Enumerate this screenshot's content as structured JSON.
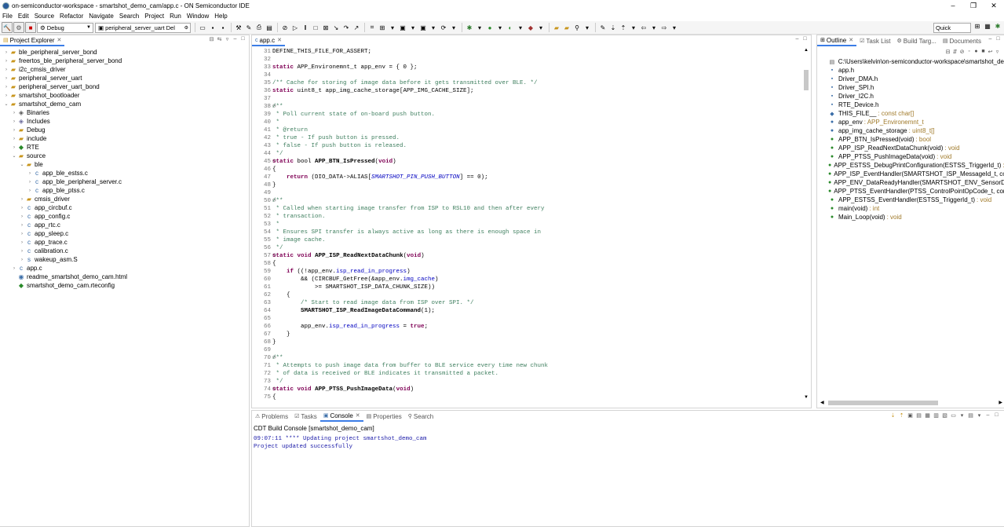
{
  "window": {
    "title": "on-semiconductor-workspace - smartshot_demo_cam/app.c - ON Semiconductor IDE",
    "controls": [
      "–",
      "❐",
      "✕"
    ]
  },
  "menu": [
    "File",
    "Edit",
    "Source",
    "Refactor",
    "Navigate",
    "Search",
    "Project",
    "Run",
    "Window",
    "Help"
  ],
  "toolbar": {
    "build_config": "Debug",
    "launch_config": "peripheral_server_uart Del",
    "quick_access": "Quick Access"
  },
  "explorer": {
    "tab": "Project Explorer",
    "items": [
      {
        "label": "ble_peripheral_server_bond",
        "depth": 0,
        "twisty": "›",
        "icon": "project-icon"
      },
      {
        "label": "freertos_ble_peripheral_server_bond",
        "depth": 0,
        "twisty": "›",
        "icon": "project-icon"
      },
      {
        "label": "i2c_cmsis_driver",
        "depth": 0,
        "twisty": "›",
        "icon": "project-icon"
      },
      {
        "label": "peripheral_server_uart",
        "depth": 0,
        "twisty": "›",
        "icon": "project-icon"
      },
      {
        "label": "peripheral_server_uart_bond",
        "depth": 0,
        "twisty": "›",
        "icon": "project-icon"
      },
      {
        "label": "smartshot_bootloader",
        "depth": 0,
        "twisty": "›",
        "icon": "project-icon"
      },
      {
        "label": "smartshot_demo_cam",
        "depth": 0,
        "twisty": "⌄",
        "icon": "project-icon"
      },
      {
        "label": "Binaries",
        "depth": 1,
        "twisty": "›",
        "icon": "binaries-icon"
      },
      {
        "label": "Includes",
        "depth": 1,
        "twisty": "›",
        "icon": "includes-icon"
      },
      {
        "label": "Debug",
        "depth": 1,
        "twisty": "›",
        "icon": "folder-icon"
      },
      {
        "label": "include",
        "depth": 1,
        "twisty": "›",
        "icon": "folder-icon"
      },
      {
        "label": "RTE",
        "depth": 1,
        "twisty": "›",
        "icon": "rte-icon"
      },
      {
        "label": "source",
        "depth": 1,
        "twisty": "⌄",
        "icon": "folder-icon"
      },
      {
        "label": "ble",
        "depth": 2,
        "twisty": "⌄",
        "icon": "folder-icon"
      },
      {
        "label": "app_ble_estss.c",
        "depth": 3,
        "twisty": "›",
        "icon": "c-file-icon"
      },
      {
        "label": "app_ble_peripheral_server.c",
        "depth": 3,
        "twisty": "›",
        "icon": "c-file-icon"
      },
      {
        "label": "app_ble_ptss.c",
        "depth": 3,
        "twisty": "›",
        "icon": "c-file-icon"
      },
      {
        "label": "cmsis_driver",
        "depth": 2,
        "twisty": "›",
        "icon": "folder-icon"
      },
      {
        "label": "app_circbuf.c",
        "depth": 2,
        "twisty": "›",
        "icon": "c-file-icon"
      },
      {
        "label": "app_config.c",
        "depth": 2,
        "twisty": "›",
        "icon": "c-file-icon"
      },
      {
        "label": "app_rtc.c",
        "depth": 2,
        "twisty": "›",
        "icon": "c-file-icon"
      },
      {
        "label": "app_sleep.c",
        "depth": 2,
        "twisty": "›",
        "icon": "c-file-icon"
      },
      {
        "label": "app_trace.c",
        "depth": 2,
        "twisty": "›",
        "icon": "c-file-icon"
      },
      {
        "label": "calibration.c",
        "depth": 2,
        "twisty": "›",
        "icon": "c-file-icon"
      },
      {
        "label": "wakeup_asm.S",
        "depth": 2,
        "twisty": "›",
        "icon": "asm-file-icon"
      },
      {
        "label": "app.c",
        "depth": 1,
        "twisty": "›",
        "icon": "c-file-icon"
      },
      {
        "label": "readme_smartshot_demo_cam.html",
        "depth": 1,
        "twisty": "",
        "icon": "html-file-icon"
      },
      {
        "label": "smartshot_demo_cam.rteconfig",
        "depth": 1,
        "twisty": "",
        "icon": "rteconfig-icon"
      }
    ]
  },
  "editor": {
    "tab": "app.c",
    "lines": [
      {
        "n": "31",
        "fold": "",
        "html": "DEFINE_THIS_FILE_FOR_ASSERT;"
      },
      {
        "n": "32",
        "fold": "",
        "html": ""
      },
      {
        "n": "33",
        "fold": "",
        "html": "<span class=\"kw\">static</span> APP_Environemnt_t app_env = { 0 };"
      },
      {
        "n": "34",
        "fold": "",
        "html": ""
      },
      {
        "n": "35",
        "fold": "",
        "html": "<span class=\"cm\">/** Cache for storing of image data before it gets transmitted over BLE. */</span>"
      },
      {
        "n": "36",
        "fold": "",
        "html": "<span class=\"kw\">static</span> uint8_t app_img_cache_storage[APP_IMG_CACHE_SIZE];"
      },
      {
        "n": "37",
        "fold": "",
        "html": ""
      },
      {
        "n": "38",
        "fold": "⊖",
        "html": "<span class=\"cm\">/**</span>"
      },
      {
        "n": "39",
        "fold": "",
        "html": "<span class=\"cm\"> * Poll current state of on-board push button.</span>"
      },
      {
        "n": "40",
        "fold": "",
        "html": "<span class=\"cm\"> *</span>"
      },
      {
        "n": "41",
        "fold": "",
        "html": "<span class=\"cm\"> * @return</span>"
      },
      {
        "n": "42",
        "fold": "",
        "html": "<span class=\"cm\"> * true - If push button is pressed.</span>"
      },
      {
        "n": "43",
        "fold": "",
        "html": "<span class=\"cm\"> * false - If push button is released.</span>"
      },
      {
        "n": "44",
        "fold": "",
        "html": "<span class=\"cm\"> */</span>"
      },
      {
        "n": "45",
        "fold": "⊖",
        "html": "<span class=\"kw\">static</span> bool <span class=\"fn\">APP_BTN_IsPressed</span>(<span class=\"kw\">void</span>)"
      },
      {
        "n": "46",
        "fold": "",
        "html": "{"
      },
      {
        "n": "47",
        "fold": "",
        "html": "    <span class=\"kw\">return</span> (DIO_DATA->ALIAS[<span class=\"it\">SMARTSHOT_PIN_PUSH_BUTTON</span>] == 0);"
      },
      {
        "n": "48",
        "fold": "",
        "html": "}"
      },
      {
        "n": "49",
        "fold": "",
        "html": ""
      },
      {
        "n": "50",
        "fold": "⊖",
        "html": "<span class=\"cm\">/**</span>"
      },
      {
        "n": "51",
        "fold": "",
        "html": "<span class=\"cm\"> * Called when starting image transfer from ISP to RSL10 and then after every</span>"
      },
      {
        "n": "52",
        "fold": "",
        "html": "<span class=\"cm\"> * transaction.</span>"
      },
      {
        "n": "53",
        "fold": "",
        "html": "<span class=\"cm\"> *</span>"
      },
      {
        "n": "54",
        "fold": "",
        "html": "<span class=\"cm\"> * Ensures SPI transfer is always active as long as there is enough space in</span>"
      },
      {
        "n": "55",
        "fold": "",
        "html": "<span class=\"cm\"> * image cache.</span>"
      },
      {
        "n": "56",
        "fold": "",
        "html": "<span class=\"cm\"> */</span>"
      },
      {
        "n": "57",
        "fold": "⊖",
        "html": "<span class=\"kw\">static</span> <span class=\"kw\">void</span> <span class=\"fn\">APP_ISP_ReadNextDataChunk</span>(<span class=\"kw\">void</span>)"
      },
      {
        "n": "58",
        "fold": "",
        "html": "{"
      },
      {
        "n": "59",
        "fold": "",
        "html": "    <span class=\"kw\">if</span> ((!app_env.<span class=\"fld\">isp_read_in_progress</span>)"
      },
      {
        "n": "60",
        "fold": "",
        "html": "        && (CIRCBUF_GetFree(&app_env.<span class=\"fld\">img_cache</span>)"
      },
      {
        "n": "61",
        "fold": "",
        "html": "            >= SMARTSHOT_ISP_DATA_CHUNK_SIZE))"
      },
      {
        "n": "62",
        "fold": "",
        "html": "    {"
      },
      {
        "n": "63",
        "fold": "",
        "html": "        <span class=\"cm\">/* Start to read image data from ISP over SPI. */</span>"
      },
      {
        "n": "64",
        "fold": "",
        "html": "        <span class=\"fn\">SMARTSHOT_ISP_ReadImageDataCommand</span>(1);"
      },
      {
        "n": "65",
        "fold": "",
        "html": ""
      },
      {
        "n": "66",
        "fold": "",
        "html": "        app_env.<span class=\"fld\">isp_read_in_progress</span> = <span class=\"kw\">true</span>;"
      },
      {
        "n": "67",
        "fold": "",
        "html": "    }"
      },
      {
        "n": "68",
        "fold": "",
        "html": "}"
      },
      {
        "n": "69",
        "fold": "",
        "html": ""
      },
      {
        "n": "70",
        "fold": "⊖",
        "html": "<span class=\"cm\">/**</span>"
      },
      {
        "n": "71",
        "fold": "",
        "html": "<span class=\"cm\"> * Attempts to push image data from buffer to BLE service every time new chunk</span>"
      },
      {
        "n": "72",
        "fold": "",
        "html": "<span class=\"cm\"> * of data is received or BLE indicates it transmitted a packet.</span>"
      },
      {
        "n": "73",
        "fold": "",
        "html": "<span class=\"cm\"> */</span>"
      },
      {
        "n": "74",
        "fold": "⊖",
        "html": "<span class=\"kw\">static</span> <span class=\"kw\">void</span> <span class=\"fn\">APP_PTSS_PushImageData</span>(<span class=\"kw\">void</span>)"
      },
      {
        "n": "75",
        "fold": "",
        "html": "{"
      }
    ]
  },
  "outline": {
    "tabs": [
      {
        "label": "Outline",
        "active": true
      },
      {
        "label": "Task List",
        "active": false
      },
      {
        "label": "Build Targ...",
        "active": false
      },
      {
        "label": "Documents",
        "active": false
      }
    ],
    "items": [
      {
        "label": "C:\\Users\\kelvin\\on-semiconductor-workspace\\smartshot_de",
        "type": "",
        "icon": "include-path-icon"
      },
      {
        "label": "app.h",
        "type": "",
        "icon": "header-include-icon"
      },
      {
        "label": "Driver_DMA.h",
        "type": "",
        "icon": "header-include-icon"
      },
      {
        "label": "Driver_SPI.h",
        "type": "",
        "icon": "header-include-icon"
      },
      {
        "label": "Driver_I2C.h",
        "type": "",
        "icon": "header-include-icon"
      },
      {
        "label": "RTE_Device.h",
        "type": "",
        "icon": "header-include-icon"
      },
      {
        "label": "THIS_FILE__",
        "type": ": const char[]",
        "icon": "variable-icon"
      },
      {
        "label": "app_env",
        "type": ": APP_Environemnt_t",
        "icon": "static-variable-icon"
      },
      {
        "label": "app_img_cache_storage",
        "type": ": uint8_t[]",
        "icon": "static-variable-icon"
      },
      {
        "label": "APP_BTN_IsPressed(void)",
        "type": ": bool",
        "icon": "static-function-icon"
      },
      {
        "label": "APP_ISP_ReadNextDataChunk(void)",
        "type": ": void",
        "icon": "static-function-icon"
      },
      {
        "label": "APP_PTSS_PushImageData(void)",
        "type": ": void",
        "icon": "static-function-icon"
      },
      {
        "label": "APP_ESTSS_DebugPrintConfiguration(ESTSS_TriggerId_t)",
        "type": ": v",
        "icon": "static-function-icon"
      },
      {
        "label": "APP_ISP_EventHandler(SMARTSHOT_ISP_MessageId_t, const",
        "type": "",
        "icon": "function-icon"
      },
      {
        "label": "APP_ENV_DataReadyHandler(SMARTSHOT_ENV_SensorData",
        "type": "",
        "icon": "function-icon"
      },
      {
        "label": "APP_PTSS_EventHandler(PTSS_ControlPointOpCode_t, const",
        "type": "",
        "icon": "function-icon"
      },
      {
        "label": "APP_ESTSS_EventHandler(ESTSS_TriggerId_t)",
        "type": ": void",
        "icon": "function-icon"
      },
      {
        "label": "main(void)",
        "type": ": int",
        "icon": "function-icon"
      },
      {
        "label": "Main_Loop(void)",
        "type": ": void",
        "icon": "function-icon"
      }
    ]
  },
  "console": {
    "tabs": [
      {
        "label": "Problems",
        "active": false
      },
      {
        "label": "Tasks",
        "active": false
      },
      {
        "label": "Console",
        "active": true
      },
      {
        "label": "Properties",
        "active": false
      },
      {
        "label": "Search",
        "active": false
      }
    ],
    "label": "CDT Build Console [smartshot_demo_cam]",
    "lines": [
      "09:07:11 **** Updating project smartshot_demo_cam",
      "Project updated successfully"
    ]
  }
}
